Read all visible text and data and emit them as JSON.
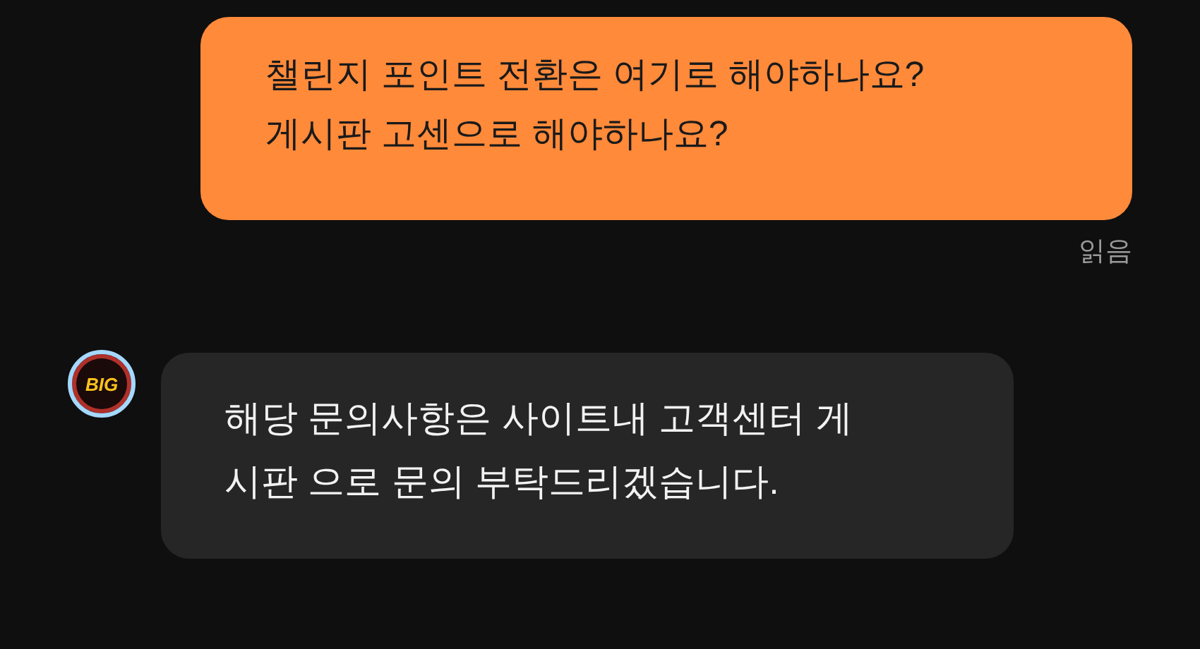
{
  "messages": [
    {
      "kind": "sent",
      "lines": [
        "챌린지 포인트 전환은 여기로 해야하나요?",
        "게시판 고센으로 해야하나요?"
      ],
      "receipt": "읽음"
    },
    {
      "kind": "received",
      "avatar": {
        "text": "BIG"
      },
      "lines": [
        "해당 문의사항은 사이트내 고객센터 게",
        "시판 으로 문의 부탁드리겠습니다."
      ]
    }
  ]
}
